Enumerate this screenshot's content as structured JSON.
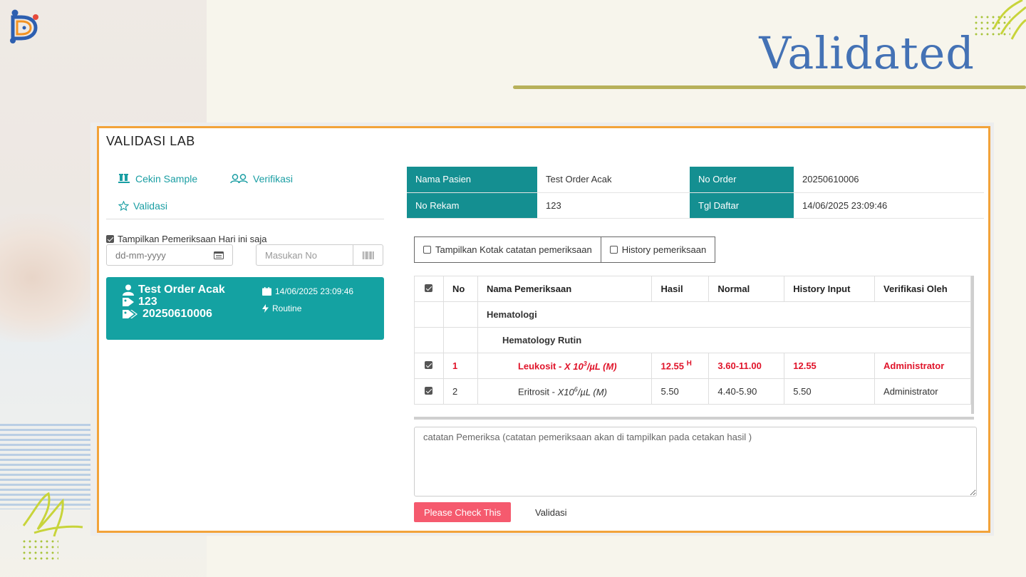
{
  "slide": {
    "title": "Validated",
    "accent_color": "#4472b5",
    "rule_color": "#b7b15a",
    "logo_icon": "dd-logo-icon"
  },
  "app": {
    "panel_title": "VALIDASI LAB",
    "border_color": "#f2a33a",
    "nav": [
      {
        "label": "Cekin Sample",
        "icon": "test-tubes-icon"
      },
      {
        "label": "Verifikasi",
        "icon": "users-icon"
      },
      {
        "label": "Validasi",
        "icon": "star-icon"
      }
    ],
    "filter": {
      "today_only_label": "Tampilkan Pemeriksaan Hari ini saja",
      "today_only_checked": true,
      "date_placeholder": "dd-mm-yyyy",
      "no_placeholder": "Masukan No"
    },
    "patient_card": {
      "name": "Test Order Acak",
      "record_no": "123",
      "order_no": "20250610006",
      "datetime": "14/06/2025 23:09:46",
      "priority": "Routine",
      "color": "#14a2a2"
    },
    "info": {
      "nama_pasien_label": "Nama Pasien",
      "nama_pasien": "Test Order Acak",
      "no_order_label": "No Order",
      "no_order": "20250610006",
      "no_rekam_label": "No Rekam",
      "no_rekam": "123",
      "tgl_daftar_label": "Tgl Daftar",
      "tgl_daftar": "14/06/2025 23:09:46"
    },
    "toggles": {
      "notes_box": "Tampilkan Kotak catatan pemeriksaan",
      "history": "History pemeriksaan"
    },
    "results": {
      "columns": [
        "No",
        "Nama Pemeriksaan",
        "Hasil",
        "Normal",
        "History Input",
        "Verifikasi Oleh"
      ],
      "group": "Hematologi",
      "subgroup": "Hematology Rutin",
      "rows": [
        {
          "no": "1",
          "name": "Leukosit - ",
          "unit_base": "X 10",
          "unit_exp": "3",
          "unit_rest": "/µL (M)",
          "hasil": "12.55",
          "flag": "H",
          "normal": "3.60-11.00",
          "history": "12.55",
          "verifier": "Administrator",
          "abnormal": true
        },
        {
          "no": "2",
          "name": "Eritrosit - ",
          "unit_base": "X10",
          "unit_exp": "6",
          "unit_rest": "/µL (M)",
          "hasil": "5.50",
          "flag": "",
          "normal": "4.40-5.90",
          "history": "5.50",
          "verifier": "Administrator",
          "abnormal": false
        }
      ],
      "abnormal_color": "#e0142a"
    },
    "notes_placeholder": "catatan Pemeriksa (catatan pemeriksaan akan di tampilkan pada cetakan hasil )",
    "buttons": {
      "check": "Please Check This",
      "validasi": "Validasi"
    }
  }
}
